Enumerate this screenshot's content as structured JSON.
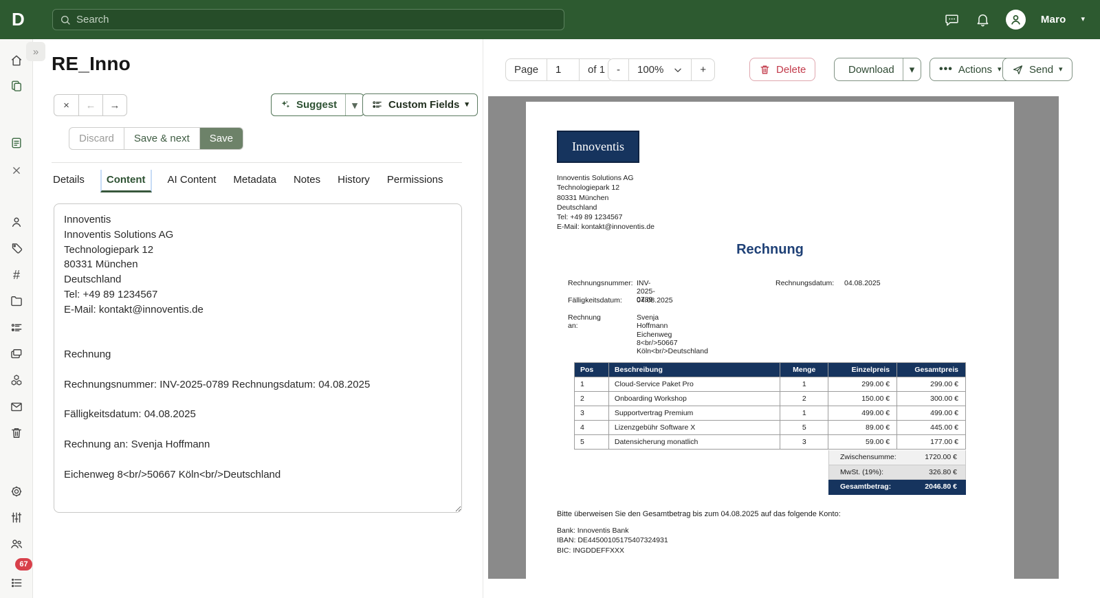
{
  "topbar": {
    "logo": "D",
    "search_placeholder": "Search",
    "user": "Maro"
  },
  "glyphs": {
    "caret": "▾",
    "chevrons_right": "»",
    "ellipsis": "•••",
    "close": "×",
    "back": "←",
    "forward": "→",
    "minus": "-",
    "plus": "+"
  },
  "header": {
    "title": "RE_Inno"
  },
  "pager": {
    "page_label": "Page",
    "page_value": "1",
    "of_label": "of 1"
  },
  "zoomctl": {
    "value": "100%"
  },
  "actions": {
    "delete": "Delete",
    "download": "Download",
    "actions": "Actions",
    "send": "Send"
  },
  "toolbar": {
    "suggest": "Suggest",
    "custom_fields": "Custom Fields"
  },
  "save_bar": {
    "discard": "Discard",
    "save_next": "Save & next",
    "save": "Save"
  },
  "tabs": [
    "Details",
    "Content",
    "AI Content",
    "Metadata",
    "Notes",
    "History",
    "Permissions"
  ],
  "sidebar": {
    "badge": "67"
  },
  "content_editor": {
    "value": "Innoventis\nInnoventis Solutions AG\nTechnologiepark 12\n80331 München\nDeutschland\nTel: +49 89 1234567\nE-Mail: kontakt@innoventis.de\n\n\nRechnung\n\nRechnungsnummer: INV-2025-0789 Rechnungsdatum: 04.08.2025\n\nFälligkeitsdatum: 04.08.2025\n\nRechnung an: Svenja Hoffmann\n\nEichenweg 8<br/>50667 Köln<br/>Deutschland"
  },
  "doc": {
    "logo": "Innoventis",
    "sender": [
      "Innoventis Solutions AG",
      "Technologiepark 12",
      "80331 München",
      "Deutschland",
      "Tel: +49 89 1234567",
      "E-Mail: kontakt@innoventis.de"
    ],
    "title": "Rechnung",
    "meta": {
      "invoice_no_label": "Rechnungsnummer:",
      "invoice_no": "INV-2025-0789",
      "date_label": "Rechnungsdatum:",
      "date": "04.08.2025",
      "due_label": "Fälligkeitsdatum:",
      "due": "04.08.2025",
      "bill_to_label": "Rechnung an:",
      "bill_to": "Svenja Hoffmann",
      "bill_to_address": "Eichenweg 8<br/>50667 Köln<br/>Deutschland"
    },
    "table": {
      "headers": [
        "Pos",
        "Beschreibung",
        "Menge",
        "Einzelpreis",
        "Gesamtpreis"
      ],
      "rows": [
        [
          "1",
          "Cloud-Service Paket Pro",
          "1",
          "299.00 €",
          "299.00 €"
        ],
        [
          "2",
          "Onboarding Workshop",
          "2",
          "150.00 €",
          "300.00 €"
        ],
        [
          "3",
          "Supportvertrag Premium",
          "1",
          "499.00 €",
          "499.00 €"
        ],
        [
          "4",
          "Lizenzgebühr Software X",
          "5",
          "89.00 €",
          "445.00 €"
        ],
        [
          "5",
          "Datensicherung monatlich",
          "3",
          "59.00 €",
          "177.00 €"
        ]
      ]
    },
    "totals": [
      {
        "label": "Zwischensumme:",
        "value": "1720.00 €"
      },
      {
        "label": "MwSt. (19%):",
        "value": "326.80 €"
      },
      {
        "label": "Gesamtbetrag:",
        "value": "2046.80 €"
      }
    ],
    "payment_note": "Bitte überweisen Sie den Gesamtbetrag bis zum 04.08.2025 auf das folgende Konto:",
    "bank": [
      "Bank: Innoventis Bank",
      "IBAN: DE44500105175407324931",
      "BIC: INGDDEFFXXX"
    ]
  },
  "colors": {
    "topbar_green": "#2d5a30",
    "accent_green": "#2e5233",
    "navy": "#16345e",
    "delete_red": "#c23a4a",
    "badge_red": "#d8404a",
    "viewer_gray": "#8a8a8a"
  }
}
